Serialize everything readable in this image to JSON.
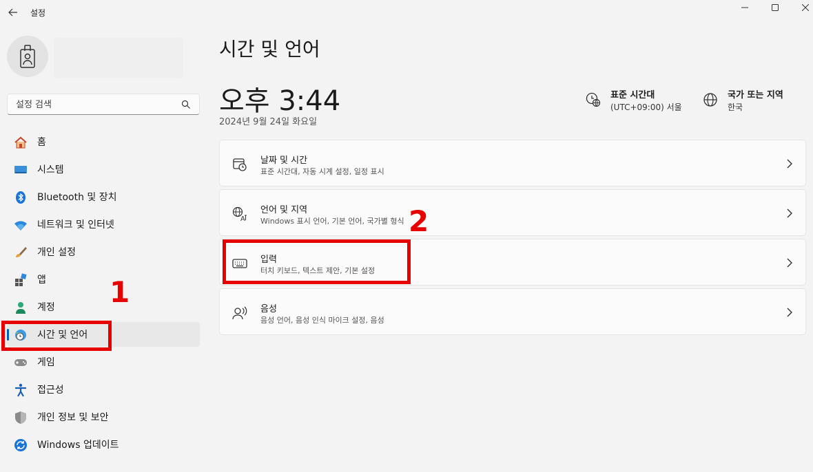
{
  "window": {
    "title": "설정",
    "minimize_icon": "minimize-icon",
    "maximize_icon": "maximize-icon",
    "close_icon": "close-icon"
  },
  "search": {
    "placeholder": "설정 검색"
  },
  "sidebar": {
    "items": [
      {
        "label": "홈",
        "icon": "home-icon",
        "active": false
      },
      {
        "label": "시스템",
        "icon": "monitor-icon",
        "active": false
      },
      {
        "label": "Bluetooth 및 장치",
        "icon": "bluetooth-icon",
        "active": false
      },
      {
        "label": "네트워크 및 인터넷",
        "icon": "wifi-icon",
        "active": false
      },
      {
        "label": "개인 설정",
        "icon": "brush-icon",
        "active": false
      },
      {
        "label": "앱",
        "icon": "apps-icon",
        "active": false
      },
      {
        "label": "계정",
        "icon": "person-icon",
        "active": false
      },
      {
        "label": "시간 및 언어",
        "icon": "globe-clock-icon",
        "active": true
      },
      {
        "label": "게임",
        "icon": "gamepad-icon",
        "active": false
      },
      {
        "label": "접근성",
        "icon": "accessibility-icon",
        "active": false
      },
      {
        "label": "개인 정보 및 보안",
        "icon": "shield-icon",
        "active": false
      },
      {
        "label": "Windows 업데이트",
        "icon": "update-icon",
        "active": false
      }
    ]
  },
  "main": {
    "title": "시간 및 언어",
    "time": "오후 3:44",
    "date": "2024년 9월 24일 화요일",
    "timezone": {
      "title": "표준 시간대",
      "value": "(UTC+09:00) 서울"
    },
    "region": {
      "title": "국가 또는 지역",
      "value": "한국"
    },
    "cards": [
      {
        "title": "날짜 및 시간",
        "subtitle": "표준 시간대, 자동 시계 설정, 일정 표시",
        "icon": "calendar-clock-icon"
      },
      {
        "title": "언어 및 지역",
        "subtitle": "Windows 표시 언어, 기본 언어, 국가별 형식",
        "icon": "language-icon"
      },
      {
        "title": "입력",
        "subtitle": "터치 키보드, 텍스트 제안, 기본 설정",
        "icon": "keyboard-icon"
      },
      {
        "title": "음성",
        "subtitle": "음성 언어, 음성 인식 마이크 설정, 음성",
        "icon": "speech-icon"
      }
    ]
  },
  "annotations": {
    "color": "#e60000",
    "step1": "1",
    "step2": "2"
  },
  "colors": {
    "accent": "#005fb8",
    "background": "#f3f3f3",
    "card": "#fbfbfb"
  }
}
